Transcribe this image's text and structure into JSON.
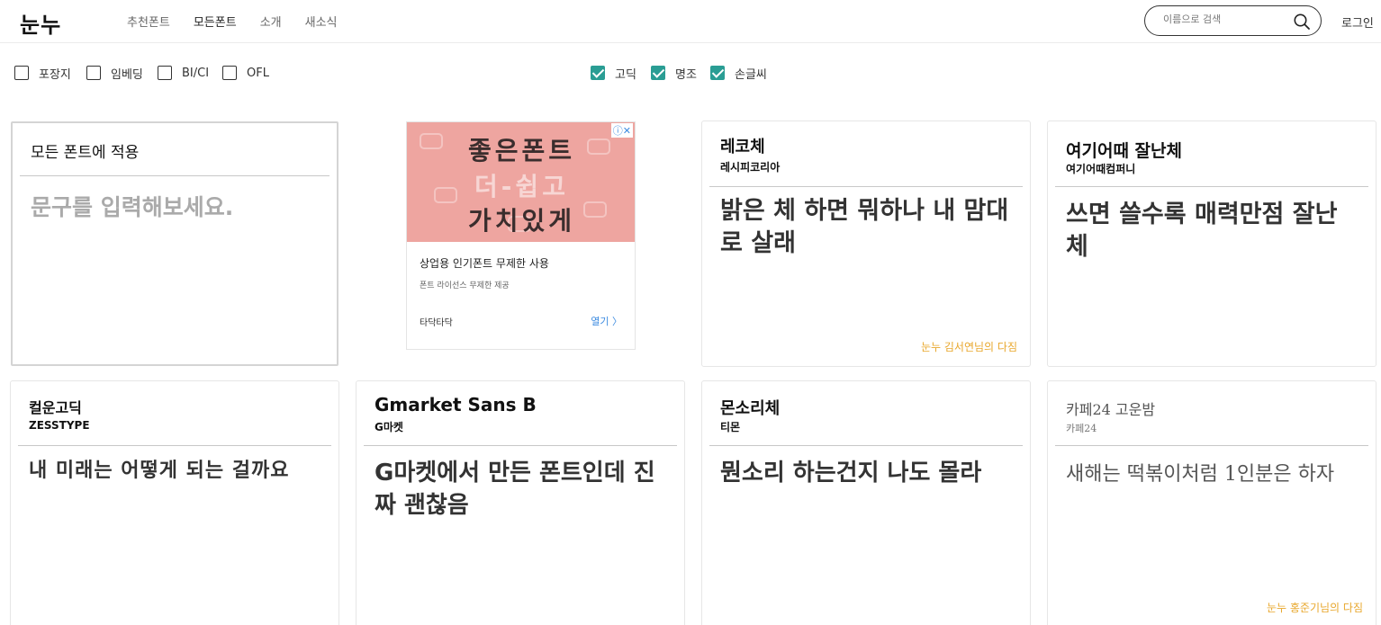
{
  "header": {
    "logo": "눈누",
    "nav": [
      "추천폰트",
      "모든폰트",
      "소개",
      "새소식"
    ],
    "search_placeholder": "이름으로 검색",
    "login": "로그인"
  },
  "filters": {
    "license": [
      {
        "label": "포장지",
        "checked": false
      },
      {
        "label": "임베딩",
        "checked": false
      },
      {
        "label": "BI/CI",
        "checked": false
      },
      {
        "label": "OFL",
        "checked": false
      }
    ],
    "style": [
      {
        "label": "고딕",
        "checked": true
      },
      {
        "label": "명조",
        "checked": true
      },
      {
        "label": "손글씨",
        "checked": true
      }
    ]
  },
  "apply_card": {
    "title": "모든 폰트에 적용",
    "placeholder": "문구를 입력해보세요."
  },
  "ad": {
    "image_lines": [
      "좋은폰트",
      "더-쉽고",
      "가치있게"
    ],
    "close": "ⓘ✕",
    "headline": "상업용 인기폰트 무제한 사용",
    "subline": "폰트 라이선스 무제한 제공",
    "brand": "타닥타닥",
    "open": "열기 〉"
  },
  "fonts": [
    {
      "name": "레코체",
      "maker": "레시피코리아",
      "sample": "밝은 체 하면 뭐하나 내 맘대로 살래",
      "credit": "눈누 김서연님의 다짐"
    },
    {
      "name": "여기어때 잘난체",
      "maker": "여기어때컴퍼니",
      "sample": "쓰면 쓸수록 매력만점 잘난체",
      "credit": ""
    },
    {
      "name": "컬운고딕",
      "maker": "ZESSTYPE",
      "sample": "내 미래는 어떻게 되는 걸까요",
      "credit": ""
    },
    {
      "name": "Gmarket Sans B",
      "maker": "G마켓",
      "sample": "G마켓에서 만든 폰트인데 진짜 괜찮음",
      "credit": ""
    },
    {
      "name": "몬소리체",
      "maker": "티몬",
      "sample": "뭔소리 하는건지 나도 몰라",
      "credit": ""
    },
    {
      "name": "카페24 고운밤",
      "maker": "카페24",
      "sample": "새해는 떡볶이처럼 1인분은 하자",
      "credit": "눈누 홍준기님의 다짐"
    }
  ],
  "colors": {
    "accent": "#2a9d94",
    "credit": "#e8a72c",
    "ad_bg": "#eea5a0"
  }
}
